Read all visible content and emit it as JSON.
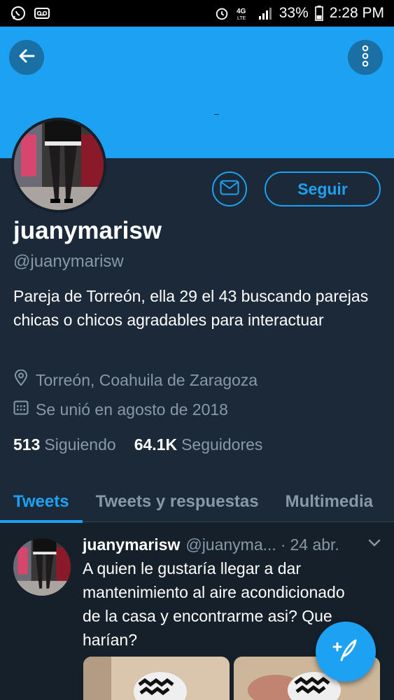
{
  "status_bar": {
    "battery_percent": "33%",
    "time": "2:28 PM",
    "icons": [
      "whatsapp-icon",
      "voicemail-icon",
      "alarm-icon",
      "4g-lte-icon",
      "signal-icon",
      "battery-icon"
    ]
  },
  "colors": {
    "accent": "#1da1f2",
    "background": "#15202b",
    "card": "#1c2938",
    "muted": "#8899a6"
  },
  "profile": {
    "display_name": "juanymarisw",
    "handle": "@juanymarisw",
    "bio": "Pareja de Torreón, ella 29 el 43 buscando parejas chicas o chicos agradables para interactuar",
    "location": "Torreón, Coahuila de Zaragoza",
    "joined": "Se unió en agosto de 2018",
    "following_count": "513",
    "following_label": "Siguiendo",
    "followers_count": "64.1K",
    "followers_label": "Seguidores",
    "follow_button": "Seguir"
  },
  "tabs": [
    {
      "label": "Tweets",
      "active": true
    },
    {
      "label": "Tweets y respuestas",
      "active": false
    },
    {
      "label": "Multimedia",
      "active": false
    }
  ],
  "tweet": {
    "name": "juanymarisw",
    "handle": "@juanyma...",
    "separator": "·",
    "date": "24 abr.",
    "text": "A quien le gustaría llegar a dar mantenimiento al aire acondicionado de la casa y encontrarme asi? Que harían?"
  }
}
